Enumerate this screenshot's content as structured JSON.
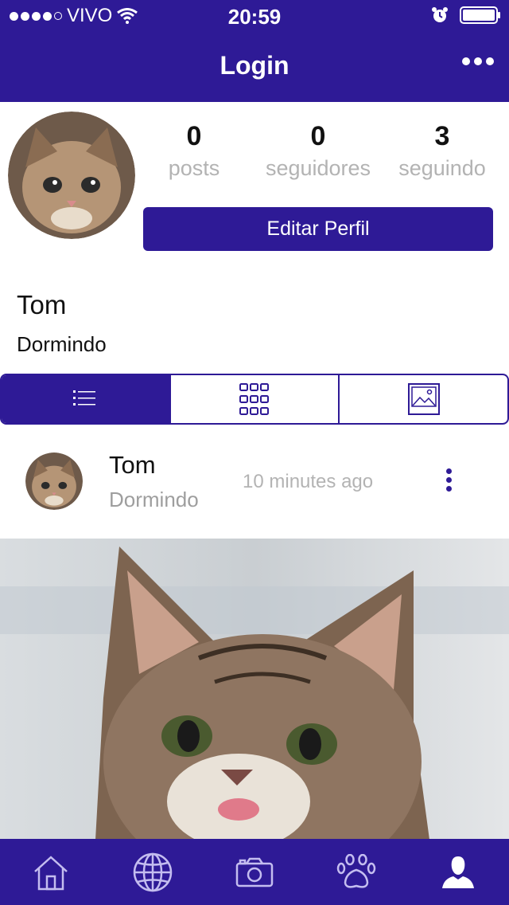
{
  "status_bar": {
    "carrier": "VIVO",
    "time": "20:59"
  },
  "nav": {
    "title": "Login"
  },
  "profile": {
    "stats": [
      {
        "value": "0",
        "label": "posts"
      },
      {
        "value": "0",
        "label": "seguidores"
      },
      {
        "value": "3",
        "label": "seguindo"
      }
    ],
    "edit_label": "Editar Perfil",
    "name": "Tom",
    "status": "Dormindo"
  },
  "view_tabs": [
    "list-icon",
    "grid-icon",
    "image-icon"
  ],
  "post": {
    "name": "Tom",
    "status": "Dormindo",
    "time": "10 minutes ago"
  },
  "tab_bar": [
    "home-icon",
    "globe-icon",
    "camera-icon",
    "paw-icon",
    "user-icon"
  ],
  "colors": {
    "accent": "#2e1a96",
    "muted_text": "#b3b3b3"
  }
}
